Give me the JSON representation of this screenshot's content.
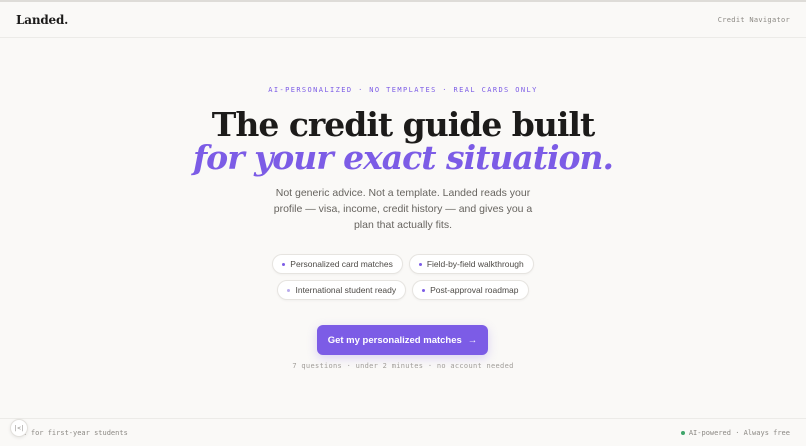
{
  "header": {
    "logo": "Landed.",
    "nav_link": "Credit Navigator"
  },
  "hero": {
    "eyebrow": "AI-PERSONALIZED · NO TEMPLATES · REAL CARDS ONLY",
    "title_line1": "The credit guide built",
    "title_line2": "for your exact situation.",
    "subtitle": "Not generic advice. Not a template. Landed reads your profile — visa, income, credit history — and gives you a plan that actually fits."
  },
  "chips": [
    {
      "label": "Personalized card matches"
    },
    {
      "label": "Field-by-field walkthrough"
    },
    {
      "label": "International student ready"
    },
    {
      "label": "Post-approval roadmap"
    }
  ],
  "cta": {
    "label": "Get my personalized matches",
    "arrow": "→",
    "meta": "7 questions · under 2 minutes · no account needed"
  },
  "footer": {
    "left": "ilt for first-year students",
    "right": "AI-powered · Always free",
    "fab": "|<|"
  },
  "colors": {
    "accent": "#7c5ce6",
    "background": "#faf9f7",
    "status_green": "#3fa56b"
  }
}
